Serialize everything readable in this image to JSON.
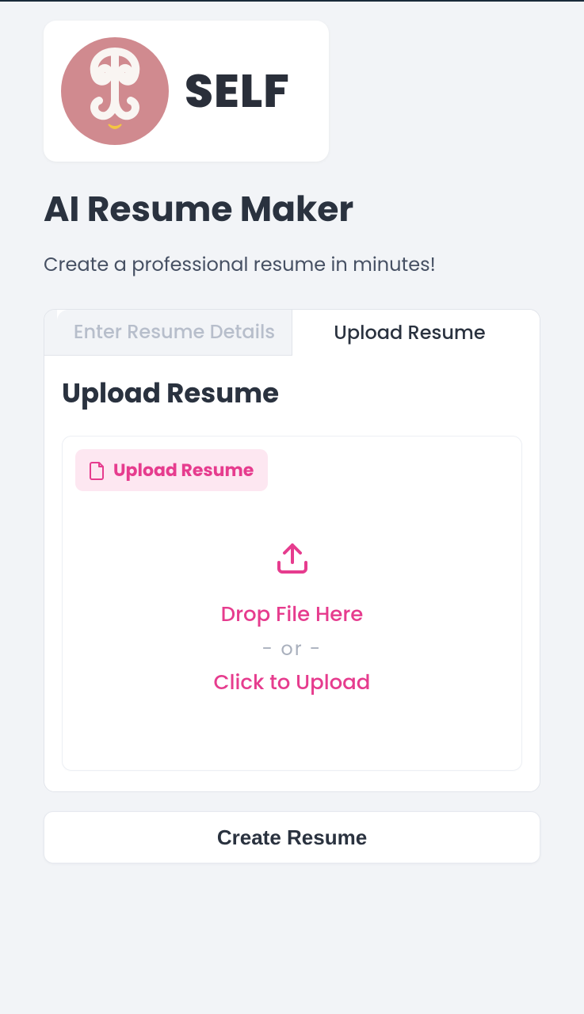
{
  "brand": {
    "name": "SELF"
  },
  "page": {
    "title": "AI Resume Maker",
    "subtitle": "Create a professional resume in minutes!"
  },
  "tabs": {
    "enter_details": "Enter Resume Details",
    "upload_resume": "Upload Resume"
  },
  "upload_section": {
    "heading": "Upload Resume",
    "pill_label": "Upload Resume",
    "drop_text": "Drop File Here",
    "or_text": "- or -",
    "click_text": "Click to Upload"
  },
  "actions": {
    "create_resume": "Create Resume"
  },
  "colors": {
    "accent": "#e63c8e",
    "brand_circle": "#d08a8f",
    "text_dark": "#2a323f"
  }
}
